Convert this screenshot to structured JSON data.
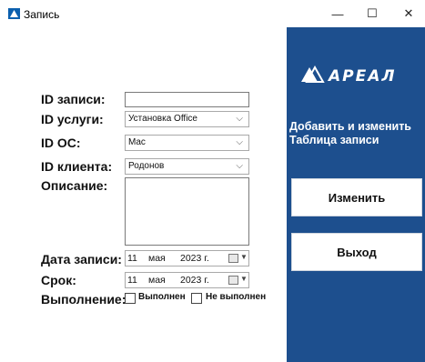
{
  "window": {
    "title": "Запись",
    "minimize_glyph": "—",
    "maximize_glyph": "☐",
    "close_glyph": "✕"
  },
  "side": {
    "logo_text": "АРЕАЛ",
    "caption_line1": "Добавить и изменить",
    "caption_line2": "Таблица записи",
    "edit_button": "Изменить",
    "exit_button": "Выход",
    "panel_color": "#1d4f8e"
  },
  "form": {
    "id_record_label": "ID записи:",
    "id_record_value": "",
    "id_service_label": "ID услуги:",
    "id_service_value": "Установка Office",
    "id_os_label": "ID ОС:",
    "id_os_value": "Mac",
    "id_client_label": "ID клиента:",
    "id_client_value": "Родонов",
    "description_label": "Описание:",
    "description_value": "",
    "record_date_label": "Дата записи:",
    "record_date": {
      "day": "11",
      "month": "мая",
      "year": "2023 г."
    },
    "deadline_label": "Срок:",
    "deadline_date": {
      "day": "11",
      "month": "мая",
      "year": "2023 г."
    },
    "completion_label": "Выполнение:",
    "done_label": "Выполнен",
    "not_done_label": "Не выполнен",
    "done_checked": false,
    "not_done_checked": false
  },
  "icons": {
    "app": "app-logo-icon",
    "dropdown": "chevron-down-icon",
    "calendar": "calendar-icon"
  }
}
